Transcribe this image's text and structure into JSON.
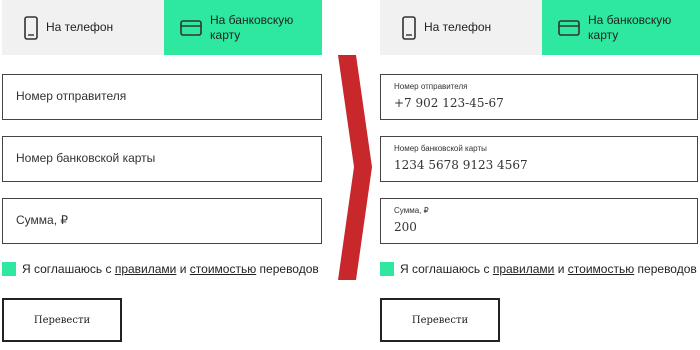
{
  "tabs": {
    "phone_label": "На телефон",
    "card_label": "На банковскую карту",
    "active_color": "#2fe8a0",
    "inactive_color": "#f1f1f1",
    "phone_icon": "smartphone-icon",
    "card_icon": "credit-card-icon"
  },
  "left_form": {
    "sender_placeholder": "Номер отправителя",
    "card_placeholder": "Номер банковской карты",
    "amount_placeholder": "Сумма, ₽"
  },
  "right_form": {
    "sender_label": "Номер отправителя",
    "sender_value": "+7 902 123-45-67",
    "card_label": "Номер банковской карты",
    "card_value": "1234 5678 9123 4567",
    "amount_label": "Сумма, ₽",
    "amount_value": "200"
  },
  "consent": {
    "prefix": "Я соглашаюсь с",
    "rules_link": "правилами",
    "conjunction": "и",
    "cost_link": "стоимостью",
    "suffix": "переводов"
  },
  "submit_label": "Перевести",
  "arrow_color": "#c8272c"
}
